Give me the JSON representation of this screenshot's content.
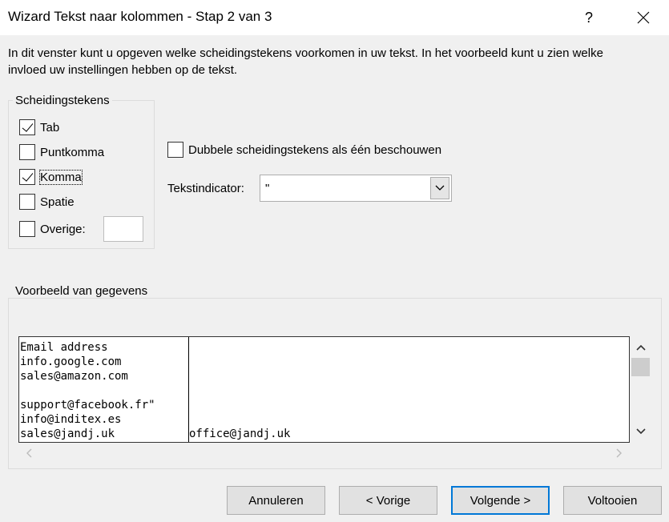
{
  "window": {
    "title": "Wizard Tekst naar kolommen - Stap 2 van 3",
    "help_label": "?"
  },
  "description": "In dit venster kunt u opgeven welke scheidingstekens voorkomen in uw tekst. In het voorbeeld kunt u zien welke invloed uw instellingen hebben op de tekst.",
  "delimiters": {
    "legend": "Scheidingstekens",
    "tab": {
      "label": "Tab",
      "checked": true
    },
    "semicolon": {
      "label": "Puntkomma",
      "checked": false
    },
    "comma": {
      "label": "Komma",
      "checked": true
    },
    "space": {
      "label": "Spatie",
      "checked": false
    },
    "other": {
      "label": "Overige:",
      "checked": false,
      "value": ""
    }
  },
  "consecutive": {
    "label": "Dubbele scheidingstekens als één beschouwen",
    "checked": false
  },
  "text_qualifier": {
    "label": "Tekstindicator:",
    "value": "\""
  },
  "preview": {
    "legend": "Voorbeeld van gegevens",
    "rows": [
      [
        "Email address",
        ""
      ],
      [
        "info.google.com",
        ""
      ],
      [
        "sales@amazon.com",
        ""
      ],
      [
        "",
        ""
      ],
      [
        "support@facebook.fr\"",
        ""
      ],
      [
        "info@inditex.es",
        ""
      ],
      [
        "sales@jandj.uk",
        "office@jandj.uk"
      ]
    ]
  },
  "buttons": {
    "cancel": "Annuleren",
    "back": "< Vorige",
    "next": "Volgende >",
    "finish": "Voltooien"
  },
  "colors": {
    "accent": "#0078d7",
    "background": "#f0f0f0"
  },
  "icons": {
    "close": "close-icon",
    "dropdown": "chevron-down-icon",
    "scroll_up": "chevron-up-icon",
    "scroll_down": "chevron-down-icon",
    "scroll_left": "chevron-left-icon",
    "scroll_right": "chevron-right-icon"
  }
}
